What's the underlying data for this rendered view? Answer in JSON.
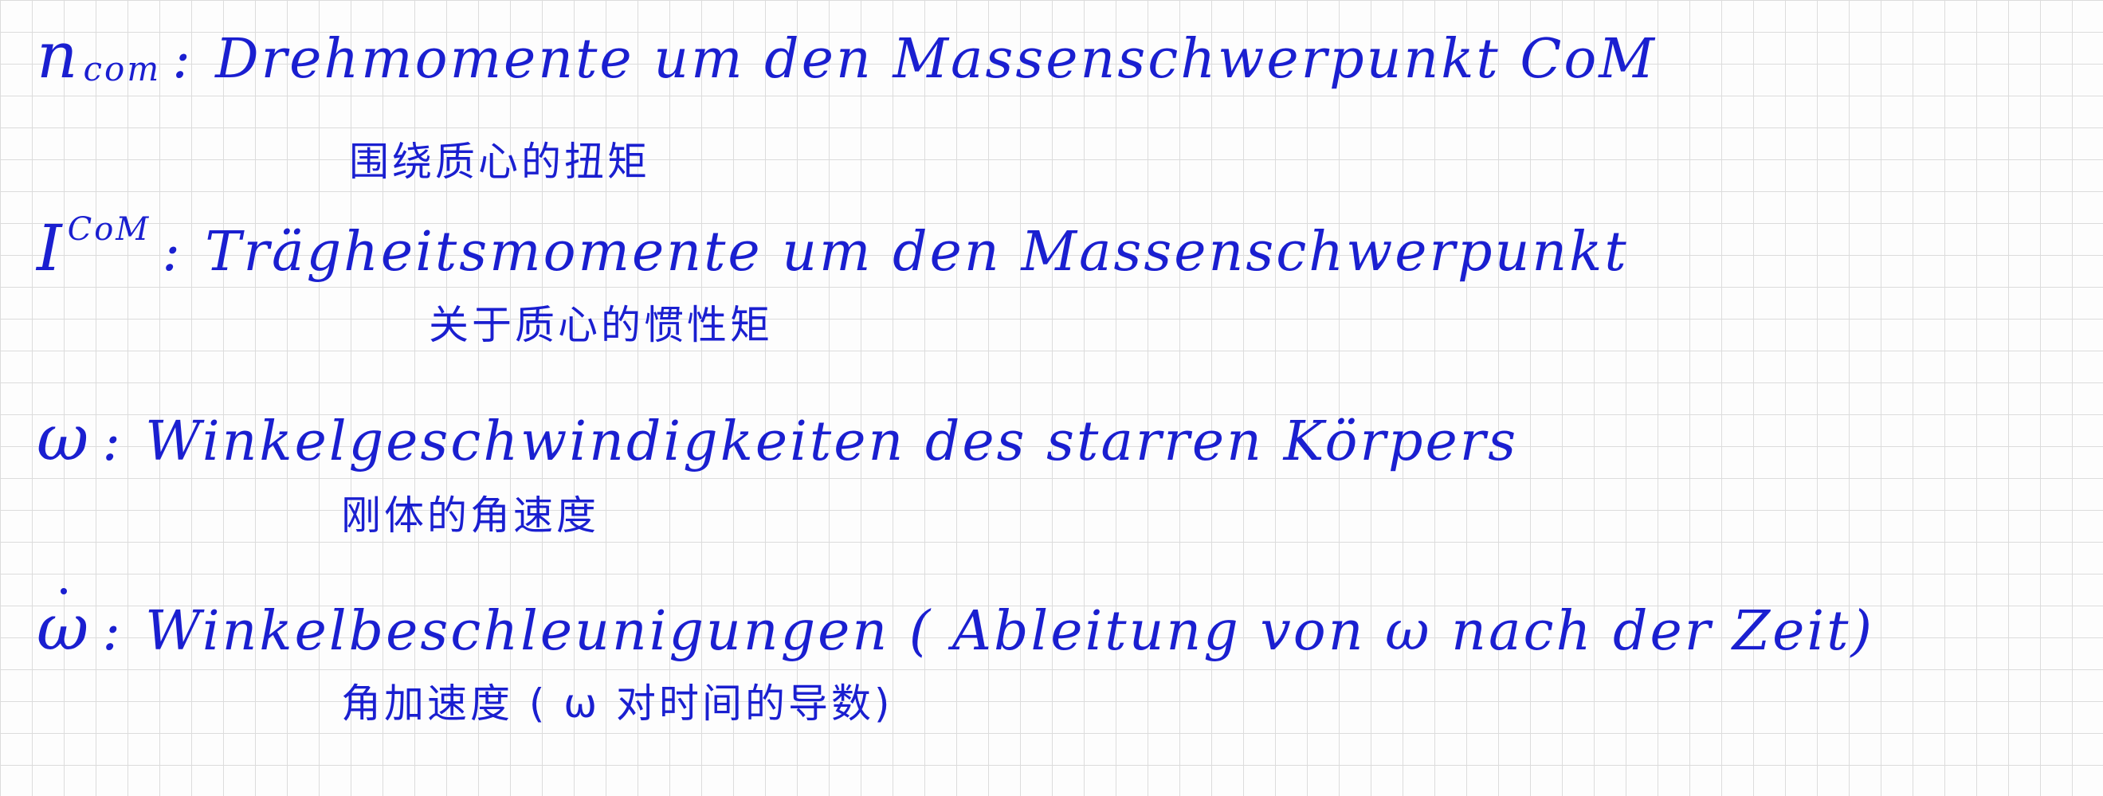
{
  "entries": [
    {
      "symbol": "n",
      "subscript": "com",
      "colon": ":",
      "german": "Drehmomente um den Massenschwerpunkt CoM",
      "chinese": "围绕质心的扭矩"
    },
    {
      "symbol": "I",
      "superscript": "CoM",
      "colon": ":",
      "german": "Trägheitsmomente um den Massenschwerpunkt",
      "chinese": "关于质心的惯性矩"
    },
    {
      "symbol": "ω",
      "colon": ":",
      "german": "Winkelgeschwindigkeiten des starren Körpers",
      "chinese": "刚体的角速度"
    },
    {
      "symbol": "ω",
      "colon": ":",
      "german": "Winkelbeschleunigungen ( Ableitung von ω nach der Zeit)",
      "chinese": "角加速度 ( ω 对时间的导数)"
    }
  ],
  "colors": {
    "ink": "#1a1fd0",
    "grid": "#dcdcdc",
    "paper": "#fdfdfd"
  }
}
